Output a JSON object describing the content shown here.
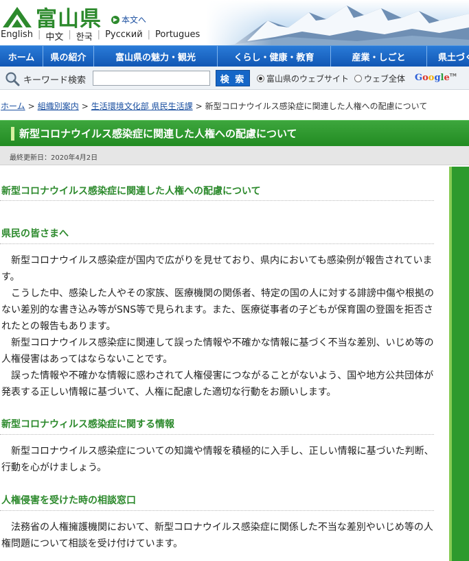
{
  "header": {
    "logo_text": "富山県",
    "honbun_link": "本文へ",
    "languages": [
      "English",
      "中文",
      "한국",
      "Русский",
      "Portugues"
    ]
  },
  "nav": {
    "items": [
      "ホーム",
      "県の紹介",
      "富山県の魅力・観光",
      "くらし・健康・教育",
      "産業・しごと",
      "県土づく"
    ]
  },
  "search": {
    "label": "キーワード検索",
    "input_value": "",
    "button_label": "検 索",
    "options": [
      "富山県のウェブサイト",
      "ウェブ全体"
    ],
    "selected_option": "富山県のウェブサイト",
    "provider": "Google"
  },
  "breadcrumb": [
    "ホーム",
    "組織別案内",
    "生活環境文化部 県民生活課",
    "新型コロナウイルス感染症に関連した人権への配慮について"
  ],
  "page": {
    "title": "新型コロナウイルス感染症に関連した人権への配慮について",
    "updated": "最終更新日：2020年4月2日"
  },
  "sections": [
    {
      "heading": "新型コロナウイルス感染症に関連した人権への配慮について",
      "paragraphs": []
    },
    {
      "heading": "県民の皆さまへ",
      "paragraphs": [
        "新型コロナウイルス感染症が国内で広がりを見せており、県内においても感染例が報告されています。",
        "こうした中、感染した人やその家族、医療機関の関係者、特定の国の人に対する誹謗中傷や根拠のない差別的な書き込み等がSNS等で見られます。また、医療従事者の子どもが保育園の登園を拒否されたとの報告もあります。",
        "新型コロナウイルス感染症に関連して誤った情報や不確かな情報に基づく不当な差別、いじめ等の人権侵害はあってはならないことです。",
        "誤った情報や不確かな情報に惑わされて人権侵害につながることがないよう、国や地方公共団体が発表する正しい情報に基づいて、人権に配慮した適切な行動をお願いします。"
      ]
    },
    {
      "heading": "新型コロナウィルス感染症に関する情報",
      "paragraphs": [
        "新型コロナウイルス感染症についての知識や情報を積極的に入手し、正しい情報に基づいた判断、行動を心がけましょう。"
      ]
    },
    {
      "heading": "人権侵害を受けた時の相談窓口",
      "paragraphs": [
        "法務省の人権擁護機関において、新型コロナウイルス感染症に関係した不当な差別やいじめ等の人権問題について相談を受け付けています。"
      ]
    }
  ],
  "colors": {
    "brand_green": "#2d8a2d",
    "nav_blue": "#1566c7",
    "link_blue": "#1a4fa0"
  }
}
